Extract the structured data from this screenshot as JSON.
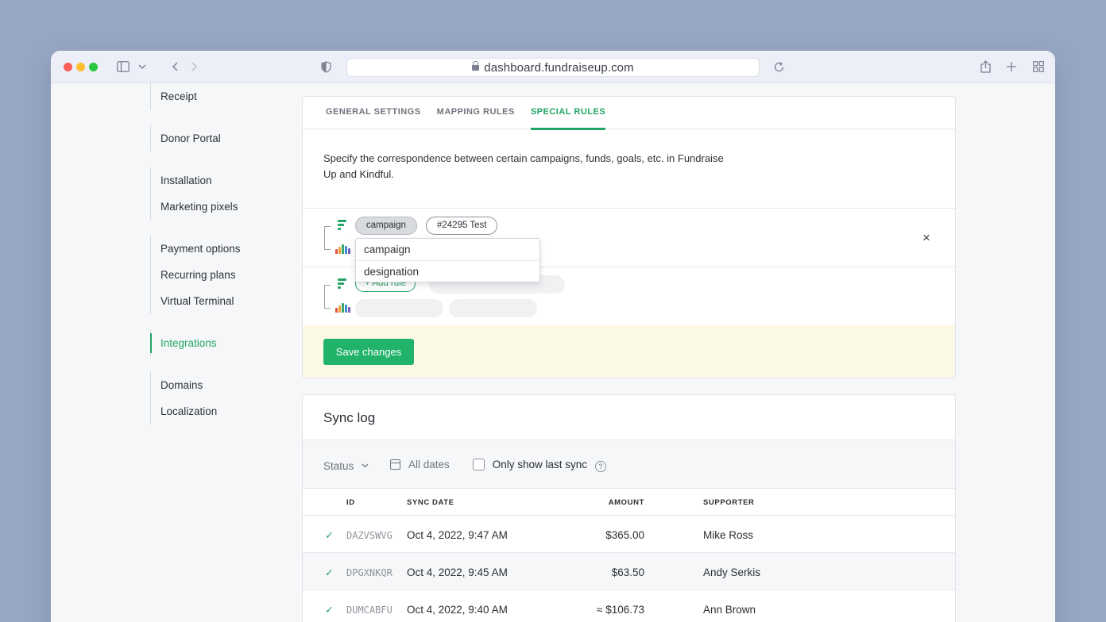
{
  "browser": {
    "url": "dashboard.fundraiseup.com"
  },
  "sidebar": {
    "groups": [
      [
        {
          "label": "Receipt"
        }
      ],
      [
        {
          "label": "Donor Portal"
        }
      ],
      [
        {
          "label": "Installation"
        },
        {
          "label": "Marketing pixels"
        }
      ],
      [
        {
          "label": "Payment options"
        },
        {
          "label": "Recurring plans"
        },
        {
          "label": "Virtual Terminal"
        }
      ],
      [
        {
          "label": "Integrations",
          "active": true
        }
      ],
      [
        {
          "label": "Domains"
        },
        {
          "label": "Localization"
        }
      ]
    ]
  },
  "settings": {
    "tabs": [
      {
        "label": "GENERAL SETTINGS"
      },
      {
        "label": "MAPPING RULES"
      },
      {
        "label": "SPECIAL RULES",
        "active": true
      }
    ],
    "description": "Specify the correspondence between certain campaigns, funds, goals, etc. in Fundraise Up and Kindful.",
    "rule": {
      "type_chip": "campaign",
      "value_chip": "#24295 Test"
    },
    "dropdown_options": [
      "campaign",
      "designation"
    ],
    "add_rule_label": "+ Add rule",
    "save_label": "Save changes"
  },
  "sync_log": {
    "title": "Sync log",
    "filters": {
      "status": "Status",
      "dates": "All dates",
      "last_sync": "Only show last sync",
      "help": "?"
    },
    "columns": {
      "id": "ID",
      "date": "SYNC DATE",
      "amount": "AMOUNT",
      "supporter": "SUPPORTER"
    },
    "rows": [
      {
        "id": "DAZVSWVG",
        "date": "Oct 4, 2022, 9:47 AM",
        "amount": "$365.00",
        "supporter": "Mike Ross"
      },
      {
        "id": "DPGXNKQR",
        "date": "Oct 4, 2022, 9:45 AM",
        "amount": "$63.50",
        "supporter": "Andy Serkis"
      },
      {
        "id": "DUMCABFU",
        "date": "Oct 4, 2022, 9:40 AM",
        "amount": "≈ $106.73",
        "supporter": "Ann Brown"
      }
    ]
  },
  "colors": {
    "accent": "#22a565",
    "save_button": "#22b36b",
    "save_bar": "#fcf8e6",
    "background": "#97a7c3"
  },
  "icons": {
    "check": "✓",
    "close": "×",
    "chevron": "⌄"
  }
}
